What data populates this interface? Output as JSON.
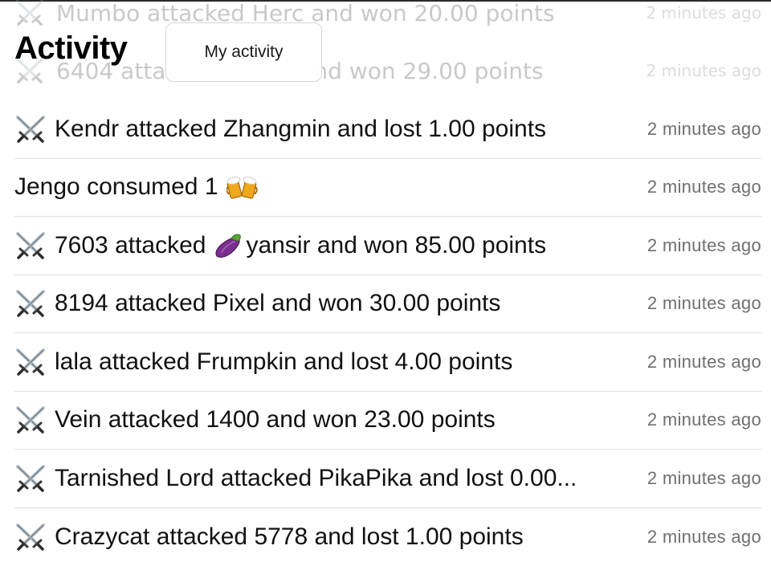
{
  "header": {
    "title": "Activity",
    "my_activity_label": "My activity"
  },
  "ghost_rows": [
    {
      "message": "Mumbo attacked Herc and won 20.00 points",
      "time": "2 minutes ago",
      "icon": "crossed-swords-icon"
    },
    {
      "message": "6404 atta",
      "message_tail": "nd won 29.00 points",
      "time": "2 minutes ago",
      "icon": "crossed-swords-icon"
    }
  ],
  "activity": {
    "rows": [
      {
        "icon": "crossed-swords-icon",
        "message": "Kendr attacked Zhangmin and lost 1.00 points",
        "time": "2 minutes ago"
      },
      {
        "icon": "",
        "message": "Jengo consumed 1",
        "trailing_emoji": "beer-mugs-icon",
        "time": "2 minutes ago"
      },
      {
        "icon": "crossed-swords-icon",
        "message_pre": "7603 attacked",
        "inline_emoji": "eggplant-icon",
        "message_post": "yansir and won 85.00 points",
        "time": "2 minutes ago"
      },
      {
        "icon": "crossed-swords-icon",
        "message": "8194 attacked Pixel and won 30.00 points",
        "time": "2 minutes ago"
      },
      {
        "icon": "crossed-swords-icon",
        "message": "lala attacked Frumpkin and lost 4.00 points",
        "time": "2 minutes ago"
      },
      {
        "icon": "crossed-swords-icon",
        "message": "Vein attacked 1400 and won 23.00 points",
        "time": "2 minutes ago"
      },
      {
        "icon": "crossed-swords-icon",
        "message": "Tarnished Lord attacked PikaPika and lost 0.00...",
        "time": "2 minutes ago"
      },
      {
        "icon": "crossed-swords-icon",
        "message": "Crazycat attacked 5778 and lost 1.00 points",
        "time": "2 minutes ago"
      }
    ]
  },
  "colors": {
    "text_primary": "#111111",
    "text_secondary": "#6f6f6f",
    "divider": "#dedede",
    "ghost_text": "#c9c9c9"
  }
}
